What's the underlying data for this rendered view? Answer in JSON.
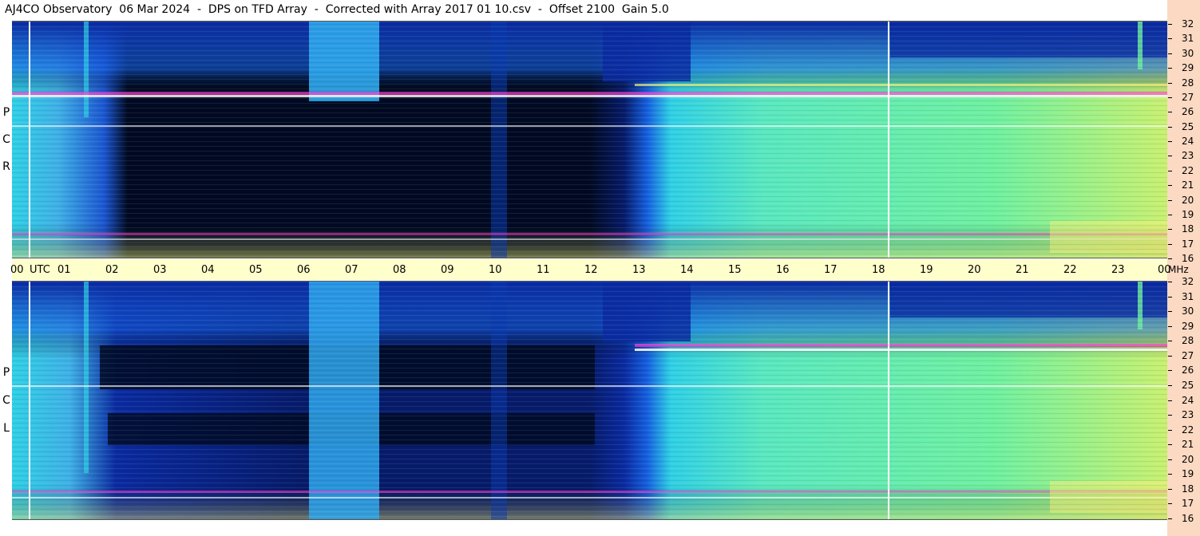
{
  "title": "AJ4CO Observatory  06 Mar 2024  -  DPS on TFD Array  -  Corrected with Array 2017 01 10.csv  -  Offset 2100  Gain 5.0",
  "chart_data": [
    {
      "type": "heatmap",
      "panel": "top",
      "polarization_letters": [
        "R",
        "C",
        "P"
      ],
      "xlabel": "UTC",
      "ylabel": "MHz",
      "xlim": [
        0,
        24
      ],
      "ylim": [
        16,
        32
      ],
      "x_tick_labels": [
        "00",
        "01",
        "02",
        "03",
        "04",
        "05",
        "06",
        "07",
        "08",
        "09",
        "10",
        "11",
        "12",
        "13",
        "14",
        "15",
        "16",
        "17",
        "18",
        "19",
        "20",
        "21",
        "22",
        "23",
        "00"
      ],
      "y_tick_labels": [
        "32",
        "31",
        "30",
        "29",
        "28",
        "27",
        "26",
        "25",
        "24",
        "23",
        "22",
        "21",
        "20",
        "19",
        "18",
        "17",
        "16"
      ]
    },
    {
      "type": "heatmap",
      "panel": "bottom",
      "polarization_letters": [
        "L",
        "C",
        "P"
      ],
      "xlabel": "UTC",
      "ylabel": "MHz",
      "xlim": [
        0,
        24
      ],
      "ylim": [
        16,
        32
      ],
      "x_tick_labels": [
        "00",
        "01",
        "02",
        "03",
        "04",
        "05",
        "06",
        "07",
        "08",
        "09",
        "10",
        "11",
        "12",
        "13",
        "14",
        "15",
        "16",
        "17",
        "18",
        "19",
        "20",
        "21",
        "22",
        "23",
        "00"
      ],
      "y_tick_labels": [
        "32",
        "31",
        "30",
        "29",
        "28",
        "27",
        "26",
        "25",
        "24",
        "23",
        "22",
        "21",
        "20",
        "19",
        "18",
        "17",
        "16"
      ]
    }
  ],
  "axis": {
    "utc_label": "UTC",
    "mhz_label": "MHz",
    "hours": [
      "00",
      "01",
      "02",
      "03",
      "04",
      "05",
      "06",
      "07",
      "08",
      "09",
      "10",
      "11",
      "12",
      "13",
      "14",
      "15",
      "16",
      "17",
      "18",
      "19",
      "20",
      "21",
      "22",
      "23",
      "00"
    ],
    "freqs": [
      "32",
      "31",
      "30",
      "29",
      "28",
      "27",
      "26",
      "25",
      "24",
      "23",
      "22",
      "21",
      "20",
      "19",
      "18",
      "17",
      "16"
    ]
  },
  "top_letters": [
    "P",
    "C",
    "R"
  ],
  "bottom_letters": [
    "P",
    "C",
    "L"
  ],
  "colors": {
    "dark": "#000a22",
    "deep_blue": "#0a2aa0",
    "blue": "#1560e0",
    "cyan": "#2fd0e6",
    "green": "#8ef07a",
    "yellow": "#f2f07a",
    "magenta": "#ff3ad0",
    "white": "#ffffff",
    "axis_bg": "#ffffcc",
    "side_strip": "#fbd9c2"
  }
}
